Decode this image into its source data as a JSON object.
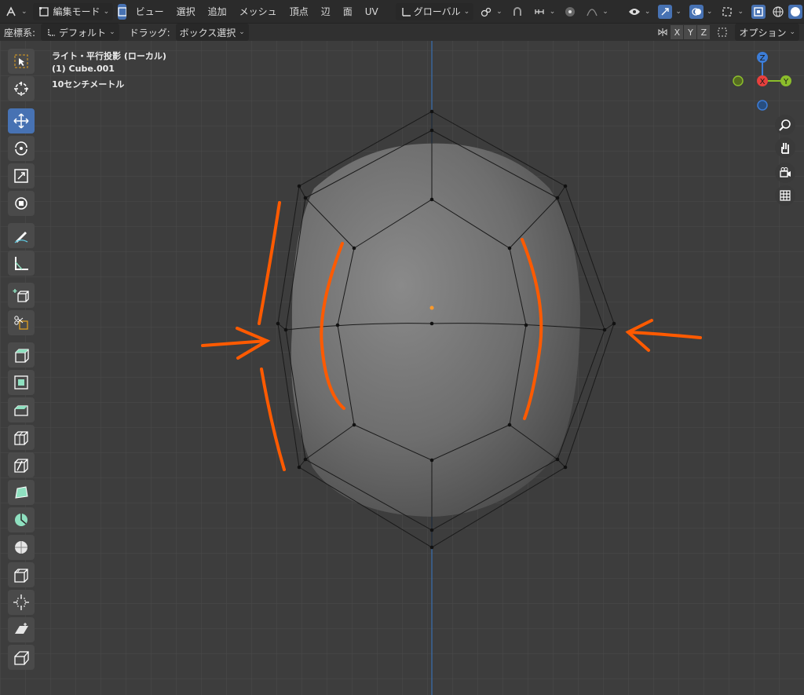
{
  "header": {
    "mode_label": "編集モード",
    "menus": [
      "ビュー",
      "選択",
      "追加",
      "メッシュ",
      "頂点",
      "辺",
      "面",
      "UV"
    ],
    "transform_orientation": "グローバル"
  },
  "tool_settings": {
    "coord_label": "座標系:",
    "coord_value": "デフォルト",
    "drag_label": "ドラッグ:",
    "drag_value": "ボックス選択",
    "axis_x": "X",
    "axis_y": "Y",
    "axis_z": "Z",
    "options_label": "オプション"
  },
  "viewport": {
    "info_line1": "ライト・平行投影 (ローカル)",
    "info_line2": "(1) Cube.001",
    "info_line3": "10センチメートル"
  },
  "gizmo": {
    "z": "Z",
    "x": "X",
    "y": "Y"
  },
  "colors": {
    "accent": "#4772b3",
    "annotation": "#ff5a00",
    "axis_x": "#e8403d",
    "axis_y": "#8bbd2b",
    "axis_z": "#3c7dd8"
  }
}
